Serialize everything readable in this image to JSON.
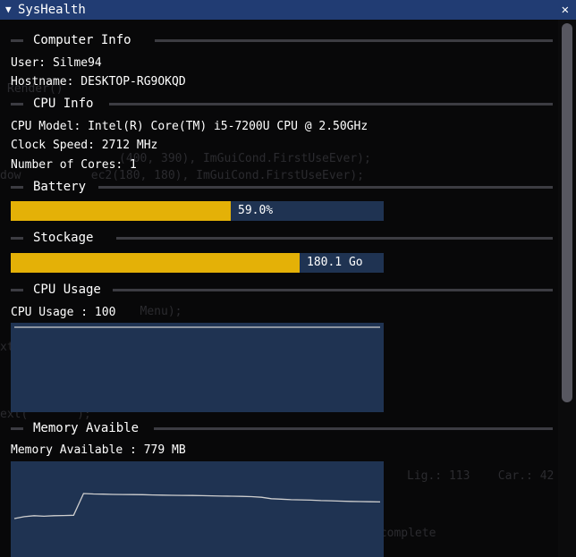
{
  "window": {
    "title": "SysHealth",
    "collapse_icon": "triangle-down-icon",
    "close_icon": "close-icon",
    "close_glyph": "✕",
    "collapse_glyph": "▼"
  },
  "computer_info": {
    "header": "Computer Info",
    "user": "User: Silme94",
    "hostname": "Hostname: DESKTOP-RG9OKQD"
  },
  "cpu_info": {
    "header": "CPU Info",
    "model": "CPU Model: Intel(R) Core(TM) i5-7200U CPU @ 2.50GHz",
    "clock": "Clock Speed: 2712 MHz",
    "cores": "Number of Cores: 1"
  },
  "battery": {
    "header": "Battery",
    "fraction": 0.59,
    "label": "59.0%"
  },
  "storage": {
    "header": "Stockage",
    "fraction": 0.775,
    "label": "180.1 Go"
  },
  "cpu_usage": {
    "header": "CPU Usage",
    "label": "CPU Usage : 100",
    "values": [
      100,
      100,
      100,
      100,
      100,
      100,
      100,
      100,
      100,
      100,
      100,
      100,
      100,
      100,
      100,
      100,
      100,
      100,
      100,
      100
    ],
    "ymin": 0,
    "ymax": 100
  },
  "memory": {
    "header": "Memory Avaible",
    "label": "Memory Available : 779 MB",
    "values": [
      780,
      800,
      810,
      805,
      810,
      812,
      815,
      1045,
      1040,
      1038,
      1036,
      1035,
      1034,
      1033,
      1030,
      1028,
      1026,
      1025,
      1024,
      1022,
      1020,
      1018,
      1017,
      1015,
      1012,
      1005,
      990,
      985,
      980,
      978,
      975,
      970,
      968,
      965,
      962,
      960,
      958,
      956
    ]
  },
  "colors": {
    "title_bar": "#213c73",
    "bar_fill": "#e4b107",
    "frame_bg": "#1f3352",
    "plot_line": "#cfcfcf"
  }
}
